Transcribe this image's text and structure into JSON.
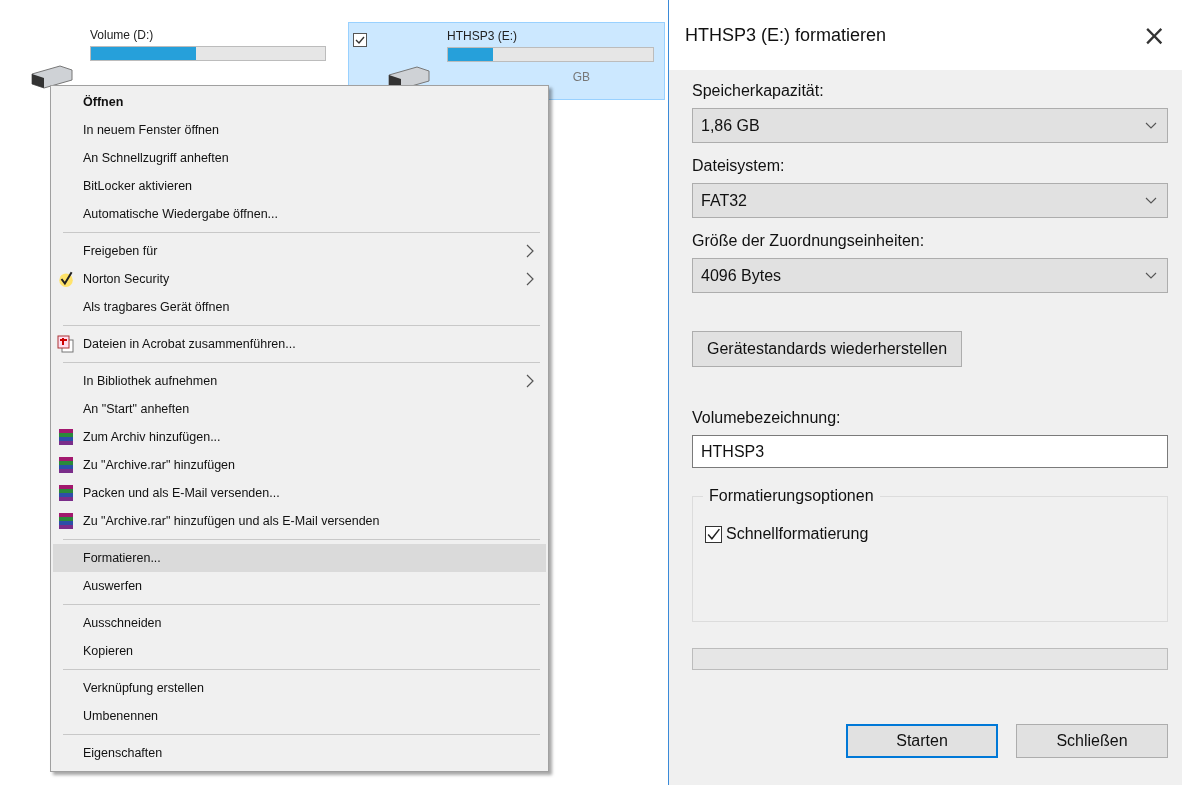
{
  "drives": [
    {
      "name": "Volume (D:)",
      "level": 0.45,
      "selected": false,
      "checked": false
    },
    {
      "name": "HTHSP3 (E:)",
      "level": 0.22,
      "selected": true,
      "checked": true,
      "info": "GB"
    }
  ],
  "context_menu": {
    "groups": [
      [
        {
          "label": "Öffnen",
          "bold": true,
          "kind": "plain",
          "submenu": false,
          "selected": false
        },
        {
          "label": "In neuem Fenster öffnen",
          "bold": false,
          "kind": "plain",
          "submenu": false,
          "selected": false
        },
        {
          "label": "An Schnellzugriff anheften",
          "bold": false,
          "kind": "plain",
          "submenu": false,
          "selected": false
        },
        {
          "label": "BitLocker aktivieren",
          "bold": false,
          "kind": "plain",
          "submenu": false,
          "selected": false
        },
        {
          "label": "Automatische Wiedergabe öffnen...",
          "bold": false,
          "kind": "plain",
          "submenu": false,
          "selected": false
        }
      ],
      [
        {
          "label": "Freigeben für",
          "bold": false,
          "kind": "plain",
          "submenu": true,
          "selected": false
        },
        {
          "label": "Norton Security",
          "bold": false,
          "kind": "check",
          "submenu": true,
          "selected": false
        },
        {
          "label": "Als tragbares Gerät öffnen",
          "bold": false,
          "kind": "plain",
          "submenu": false,
          "selected": false
        }
      ],
      [
        {
          "label": "Dateien in Acrobat zusammenführen...",
          "bold": false,
          "kind": "acrobat",
          "submenu": false,
          "selected": false
        }
      ],
      [
        {
          "label": "In Bibliothek aufnehmen",
          "bold": false,
          "kind": "plain",
          "submenu": true,
          "selected": false
        },
        {
          "label": "An \"Start\" anheften",
          "bold": false,
          "kind": "plain",
          "submenu": false,
          "selected": false
        },
        {
          "label": "Zum Archiv hinzufügen...",
          "bold": false,
          "kind": "archive",
          "submenu": false,
          "selected": false
        },
        {
          "label": "Zu \"Archive.rar\" hinzufügen",
          "bold": false,
          "kind": "archive",
          "submenu": false,
          "selected": false
        },
        {
          "label": "Packen und als E-Mail versenden...",
          "bold": false,
          "kind": "archive",
          "submenu": false,
          "selected": false
        },
        {
          "label": "Zu \"Archive.rar\" hinzufügen und als E-Mail versenden",
          "bold": false,
          "kind": "archive",
          "submenu": false,
          "selected": false
        }
      ],
      [
        {
          "label": "Formatieren...",
          "bold": false,
          "kind": "plain",
          "submenu": false,
          "selected": true
        },
        {
          "label": "Auswerfen",
          "bold": false,
          "kind": "plain",
          "submenu": false,
          "selected": false
        }
      ],
      [
        {
          "label": "Ausschneiden",
          "bold": false,
          "kind": "plain",
          "submenu": false,
          "selected": false
        },
        {
          "label": "Kopieren",
          "bold": false,
          "kind": "plain",
          "submenu": false,
          "selected": false
        }
      ],
      [
        {
          "label": "Verknüpfung erstellen",
          "bold": false,
          "kind": "plain",
          "submenu": false,
          "selected": false
        },
        {
          "label": "Umbenennen",
          "bold": false,
          "kind": "plain",
          "submenu": false,
          "selected": false
        }
      ],
      [
        {
          "label": "Eigenschaften",
          "bold": false,
          "kind": "plain",
          "submenu": false,
          "selected": false
        }
      ]
    ]
  },
  "dialog": {
    "title": "HTHSP3 (E:) formatieren",
    "close": "×",
    "fields": [
      {
        "label": "Speicherkapazität:",
        "value": "1,86 GB"
      },
      {
        "label": "Dateisystem:",
        "value": "FAT32"
      },
      {
        "label": "Größe der Zuordnungseinheiten:",
        "value": "4096 Bytes"
      }
    ],
    "restore_button": "Gerätestandards wiederherstellen",
    "volume_label": {
      "label": "Volumebezeichnung:",
      "value": "HTHSP3"
    },
    "options": {
      "title": "Formatierungsoptionen",
      "quick_format": {
        "label": "Schnellformatierung",
        "checked": true
      }
    },
    "progress": {
      "level": 0
    },
    "buttons": [
      {
        "label": "Starten",
        "default": true
      },
      {
        "label": "Schließen",
        "default": false
      }
    ]
  }
}
